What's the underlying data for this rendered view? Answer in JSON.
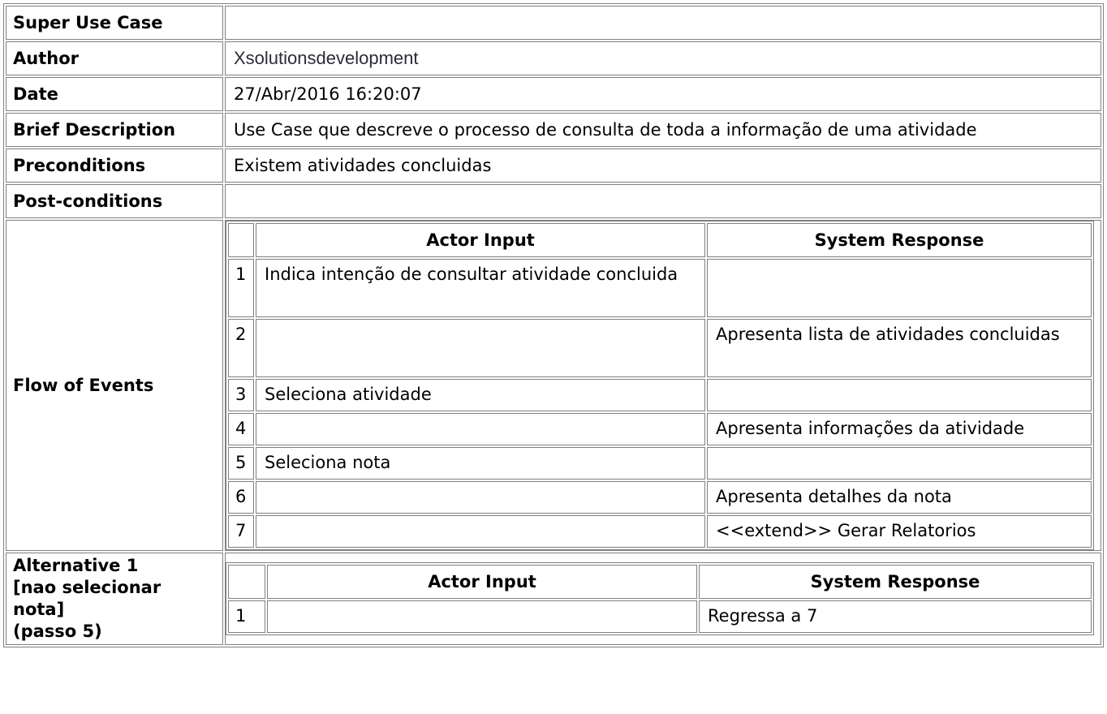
{
  "rows": {
    "super_use_case": {
      "label": "Super Use Case",
      "value": ""
    },
    "author": {
      "label": "Author",
      "value": "Xsolutionsdevelopment"
    },
    "date": {
      "label": "Date",
      "value": "27/Abr/2016 16:20:07"
    },
    "brief_description": {
      "label": "Brief Description",
      "value": "Use Case que descreve o processo de consulta de toda a informação de uma atividade"
    },
    "preconditions": {
      "label": "Preconditions",
      "value": "Existem atividades concluidas"
    },
    "post_conditions": {
      "label": "Post-conditions",
      "value": ""
    }
  },
  "flow": {
    "label": "Flow of Events",
    "headers": {
      "actor": "Actor Input",
      "system": "System Response"
    },
    "steps": [
      {
        "num": "1",
        "actor": "Indica intenção de consultar atividade concluida",
        "system": ""
      },
      {
        "num": "2",
        "actor": "",
        "system": "Apresenta lista de atividades concluidas"
      },
      {
        "num": "3",
        "actor": "Seleciona atividade",
        "system": ""
      },
      {
        "num": "4",
        "actor": "",
        "system": "Apresenta informações da atividade"
      },
      {
        "num": "5",
        "actor": "Seleciona nota",
        "system": ""
      },
      {
        "num": "6",
        "actor": "",
        "system": "Apresenta detalhes da nota"
      },
      {
        "num": "7",
        "actor": "",
        "system": "<<extend>> Gerar Relatorios"
      }
    ]
  },
  "alternative": {
    "label_lines": [
      "Alternative 1",
      "[nao selecionar",
      "nota]",
      "(passo 5)"
    ],
    "headers": {
      "actor": "Actor Input",
      "system": "System Response"
    },
    "steps": [
      {
        "num": "1",
        "actor": "",
        "system": "Regressa a 7"
      }
    ]
  }
}
